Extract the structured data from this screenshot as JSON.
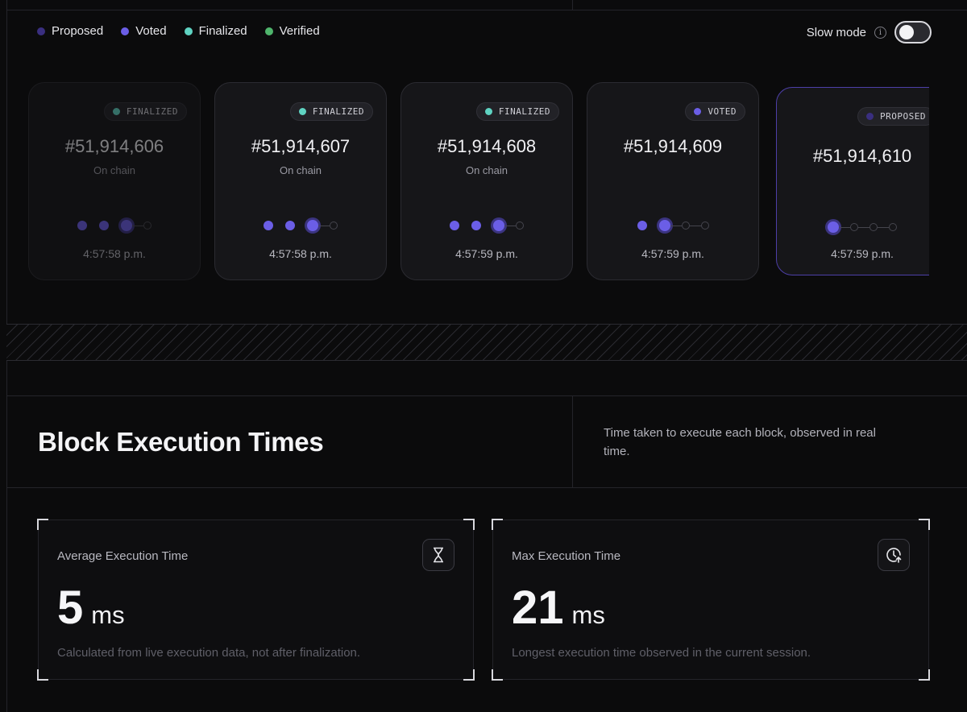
{
  "legend": {
    "items": [
      {
        "label": "Proposed",
        "color": "#3a2f80"
      },
      {
        "label": "Voted",
        "color": "#6b5ee6"
      },
      {
        "label": "Finalized",
        "color": "#5fd3c2"
      },
      {
        "label": "Verified",
        "color": "#4fb56c"
      }
    ]
  },
  "slow_mode": {
    "label": "Slow mode",
    "info_icon": "i",
    "enabled": false
  },
  "blocks": [
    {
      "status": "FINALIZED",
      "status_color": "#5fd3c2",
      "number": "#51,914,606",
      "subtitle": "On chain",
      "time": "4:57:58 p.m.",
      "progress_filled": 3,
      "progress_total": 4
    },
    {
      "status": "FINALIZED",
      "status_color": "#5fd3c2",
      "number": "#51,914,607",
      "subtitle": "On chain",
      "time": "4:57:58 p.m.",
      "progress_filled": 3,
      "progress_total": 4
    },
    {
      "status": "FINALIZED",
      "status_color": "#5fd3c2",
      "number": "#51,914,608",
      "subtitle": "On chain",
      "time": "4:57:59 p.m.",
      "progress_filled": 3,
      "progress_total": 4
    },
    {
      "status": "VOTED",
      "status_color": "#6b5ee6",
      "number": "#51,914,609",
      "subtitle": "",
      "time": "4:57:59 p.m.",
      "progress_filled": 2,
      "progress_total": 4
    },
    {
      "status": "PROPOSED",
      "status_color": "#3a2f80",
      "number": "#51,914,610",
      "subtitle": "",
      "time": "4:57:59 p.m.",
      "progress_filled": 1,
      "progress_total": 4
    }
  ],
  "section": {
    "title": "Block Execution Times",
    "description": "Time taken to execute each block, observed in real time."
  },
  "stats": {
    "average": {
      "label": "Average Execution Time",
      "value": "5",
      "unit": "ms",
      "note": "Calculated from live execution data, not after finalization.",
      "icon": "hourglass-icon"
    },
    "max": {
      "label": "Max Execution Time",
      "value": "21",
      "unit": "ms",
      "note": "Longest execution time observed in the current session.",
      "icon": "clock-arrow-icon"
    }
  }
}
